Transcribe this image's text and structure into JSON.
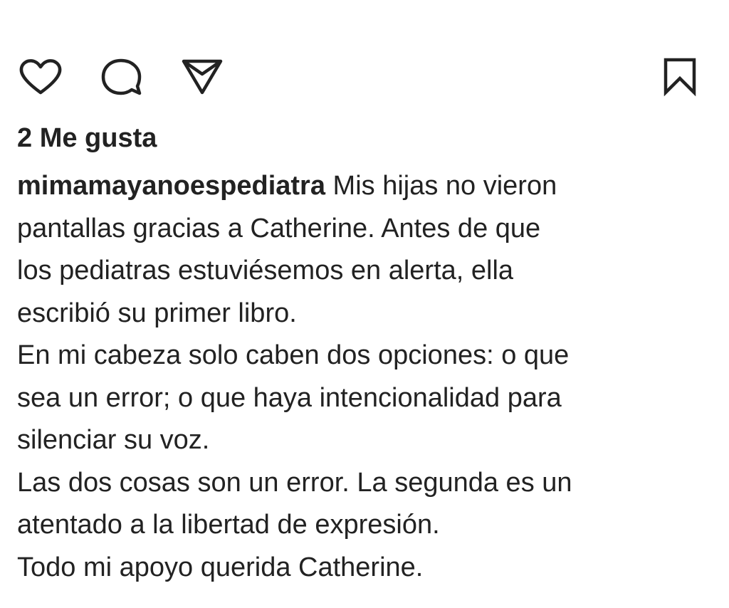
{
  "actions": {
    "like_icon": "heart-outline",
    "comment_icon": "speech-bubble-outline",
    "share_icon": "paper-plane-outline",
    "save_icon": "bookmark-outline"
  },
  "post": {
    "likes": "2 Me gusta",
    "username": "mimamayanoespediatra",
    "caption_lines": [
      " Mis hijas no vieron",
      "pantallas gracias a Catherine. Antes de que",
      "los pediatras estuviésemos en alerta, ella",
      "escribió su primer libro.",
      "En mi cabeza solo caben dos opciones: o que",
      "sea un error; o que haya intencionalidad para",
      "silenciar su voz.",
      "Las dos cosas son un error. La segunda es un",
      "atentado a la libertad de expresión.",
      "Todo mi apoyo querida Catherine."
    ]
  }
}
